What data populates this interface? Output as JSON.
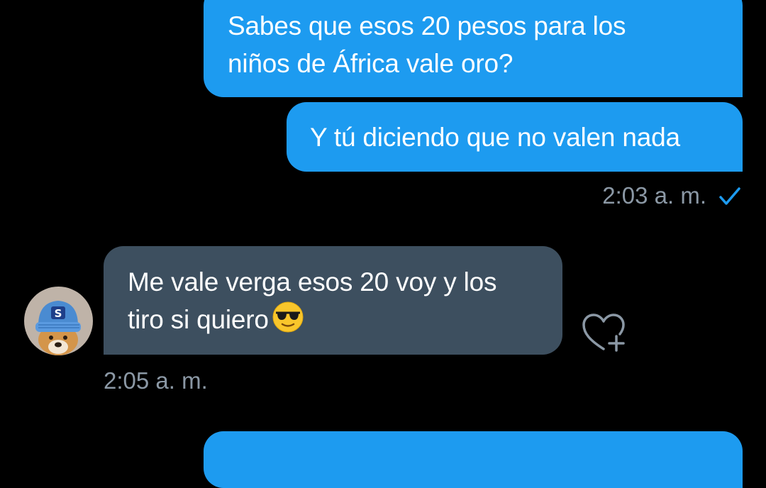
{
  "conversation": {
    "messages": [
      {
        "direction": "sent",
        "lines": [
          "Sabes que esos 20 pesos para los",
          "niños de África vale oro?"
        ]
      },
      {
        "direction": "sent",
        "lines": [
          "Y tú diciendo que no valen nada"
        ]
      },
      {
        "direction": "received",
        "lines": [
          "Me vale verga esos 20 voy y los",
          "tiro si quiero"
        ],
        "emoji": "smiling-face-with-sunglasses"
      },
      {
        "direction": "sent",
        "lines": [
          ""
        ]
      }
    ],
    "sent_timestamp": "2:03 a. m.",
    "received_timestamp": "2:05 a. m.",
    "sent_status_icon": "check-icon"
  },
  "colors": {
    "background": "#000000",
    "sent_bubble": "#1d9bf0",
    "received_bubble": "#3d4f5f",
    "timestamp_text": "#8b98a5",
    "check": "#1d9bf0"
  },
  "icons": [
    "avatar-dog-beanie",
    "add-reaction-icon",
    "check-icon",
    "sunglasses-emoji"
  ]
}
